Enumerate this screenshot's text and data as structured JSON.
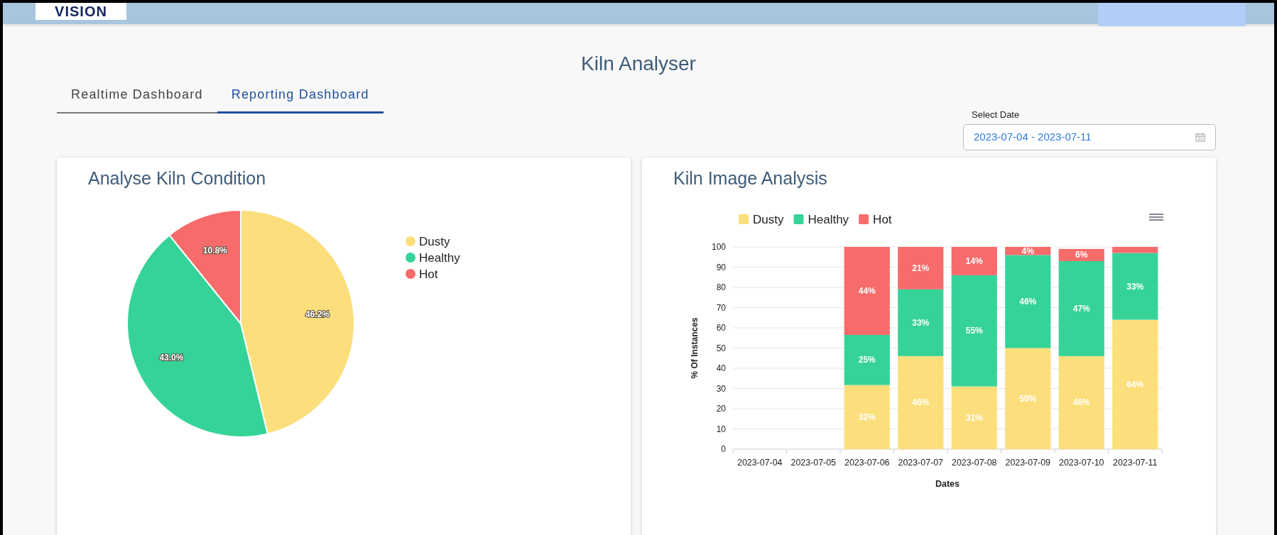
{
  "header": {
    "logo": "VISION"
  },
  "title": "Kiln Analyser",
  "tabs": [
    {
      "label": "Realtime Dashboard",
      "selected": false
    },
    {
      "label": "Reporting Dashboard",
      "selected": true
    }
  ],
  "date_filter": {
    "label": "Select Date",
    "value": "2023-07-04 - 2023-07-11"
  },
  "cards": [
    {
      "title": "Analyse Kiln Condition",
      "chart_data": {
        "type": "pie",
        "categories": [
          "Dusty",
          "Healthy",
          "Hot"
        ],
        "values": [
          46.2,
          43.0,
          10.8
        ],
        "colors": [
          "#fcdf7c",
          "#36d399",
          "#f76b6b"
        ],
        "value_labels": [
          "46.2%",
          "43.0%",
          "10.8%"
        ],
        "legend": true
      }
    },
    {
      "title": "Kiln Image Analysis",
      "chart_data": {
        "type": "bar",
        "stacked": true,
        "grid": true,
        "legend": true,
        "xlabel": "Dates",
        "ylabel": "% Of Instances",
        "categories": [
          "2023-07-04",
          "2023-07-05",
          "2023-07-06",
          "2023-07-07",
          "2023-07-08",
          "2023-07-09",
          "2023-07-10",
          "2023-07-11"
        ],
        "ylim": [
          0,
          100
        ],
        "yticks": [
          0,
          10,
          20,
          30,
          40,
          50,
          60,
          70,
          80,
          90,
          100
        ],
        "series": [
          {
            "name": "Dusty",
            "color": "#fcdf7c",
            "values": [
              null,
              null,
              31.7,
              46,
              31,
              50,
              46,
              64
            ],
            "value_labels": [
              null,
              null,
              "32%",
              "46%",
              "31%",
              "50%",
              "46%",
              "64%"
            ]
          },
          {
            "name": "Healthy",
            "color": "#36d399",
            "values": [
              null,
              null,
              24.8,
              33,
              55,
              46,
              47,
              33
            ],
            "value_labels": [
              null,
              null,
              "25%",
              "33%",
              "55%",
              "46%",
              "47%",
              "33%"
            ]
          },
          {
            "name": "Hot",
            "color": "#f76b6b",
            "values": [
              null,
              null,
              43.5,
              21,
              14,
              4,
              6,
              3
            ],
            "value_labels": [
              null,
              null,
              "44%",
              "21%",
              "14%",
              "4%",
              "6%",
              null
            ]
          }
        ]
      }
    }
  ]
}
